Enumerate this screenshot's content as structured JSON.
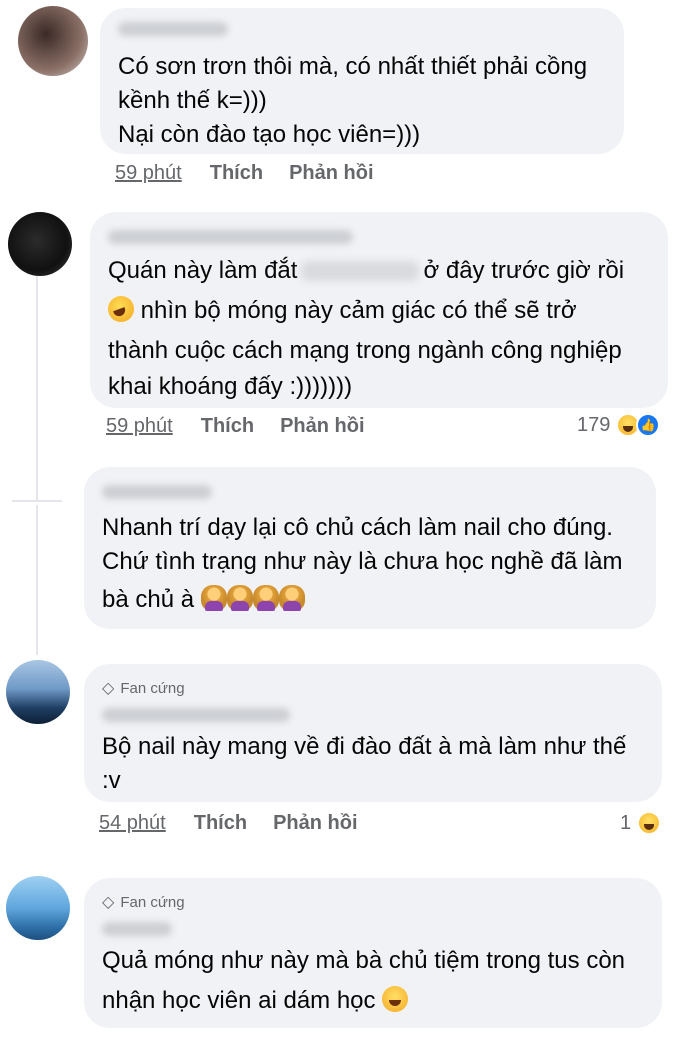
{
  "badges": {
    "fan": "Fan cứng"
  },
  "comments": [
    {
      "lines": [
        "Có sơn trơn thôi mà, có nhất thiết phải cồng",
        "kềnh thế k=)))",
        "Nại còn đào tạo học viên=)))"
      ],
      "time": "59 phút",
      "like": "Thích",
      "reply": "Phản hồi"
    },
    {
      "line1_before": "Quán này làm đắt",
      "line1_after": "ở đây trước giờ rồi",
      "line2": "nhìn bộ móng này cảm giác có thể sẽ trở",
      "line3": "thành cuộc cách mạng trong ngành công nghiệp",
      "line4": "khai khoáng đấy :)))))))",
      "time": "59 phút",
      "like": "Thích",
      "reply": "Phản hồi",
      "reaction_count": "179"
    },
    {
      "lines": [
        "Nhanh trí dạy lại cô chủ cách làm nail cho đúng.",
        "Chứ tình trạng như này là chưa học nghề đã làm",
        "bà chủ à"
      ]
    },
    {
      "lines": [
        "Bộ nail này mang về đi đào đất à mà làm như thế",
        ":v"
      ],
      "time": "54 phút",
      "like": "Thích",
      "reply": "Phản hồi",
      "reaction_count": "1"
    },
    {
      "lines": [
        "Quả móng như này mà bà chủ tiệm trong tus còn",
        "nhận học viên ai dám học"
      ]
    }
  ]
}
